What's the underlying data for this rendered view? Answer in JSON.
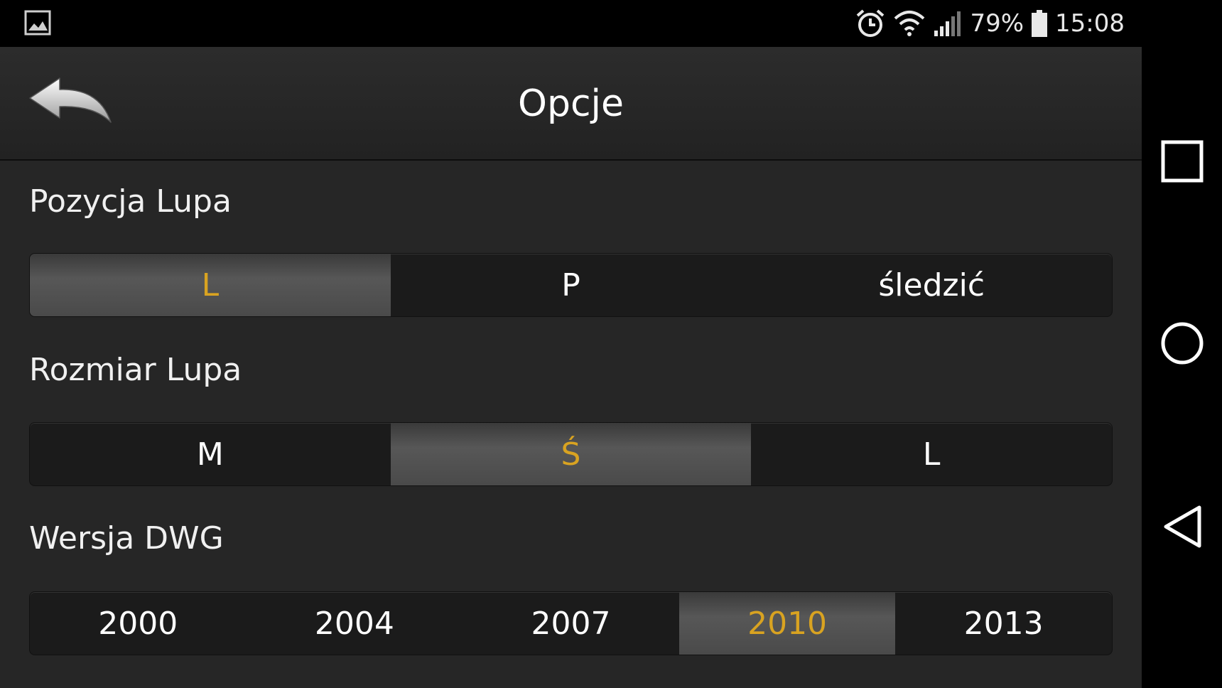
{
  "status_bar": {
    "battery_percent": "79%",
    "time": "15:08"
  },
  "app_bar": {
    "title": "Opcje"
  },
  "sections": [
    {
      "label": "Pozycja Lupa",
      "options": [
        "L",
        "P",
        "śledzić"
      ],
      "selected": 0
    },
    {
      "label": "Rozmiar Lupa",
      "options": [
        "M",
        "Ś",
        "L"
      ],
      "selected": 1
    },
    {
      "label": "Wersja DWG",
      "options": [
        "2000",
        "2004",
        "2007",
        "2010",
        "2013"
      ],
      "selected": 3
    }
  ],
  "colors": {
    "accent": "#d9a321",
    "background": "#262626"
  }
}
